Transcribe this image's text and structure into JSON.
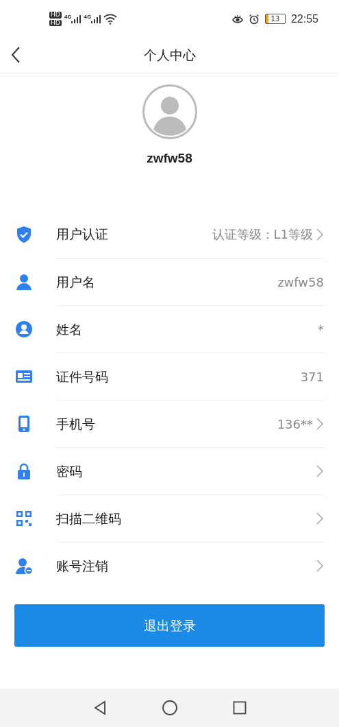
{
  "status_bar": {
    "sim_labels": [
      "HD",
      "HD"
    ],
    "network_labels": [
      "4G",
      "4G"
    ],
    "battery": "13",
    "time": "22:55"
  },
  "header": {
    "title": "个人中心"
  },
  "profile": {
    "username": "zwfw58"
  },
  "rows": [
    {
      "label": "用户认证",
      "value": "认证等级：L1等级",
      "chevron": true
    },
    {
      "label": "用户名",
      "value": "zwfw58",
      "chevron": false
    },
    {
      "label": "姓名",
      "value": "*",
      "chevron": false
    },
    {
      "label": "证件号码",
      "value": "371",
      "chevron": false
    },
    {
      "label": "手机号",
      "value": "136**",
      "chevron": true
    },
    {
      "label": "密码",
      "chevron": true
    },
    {
      "label": "扫描二维码",
      "chevron": true
    },
    {
      "label": "账号注销",
      "chevron": true
    }
  ],
  "logout_button": "退出登录"
}
